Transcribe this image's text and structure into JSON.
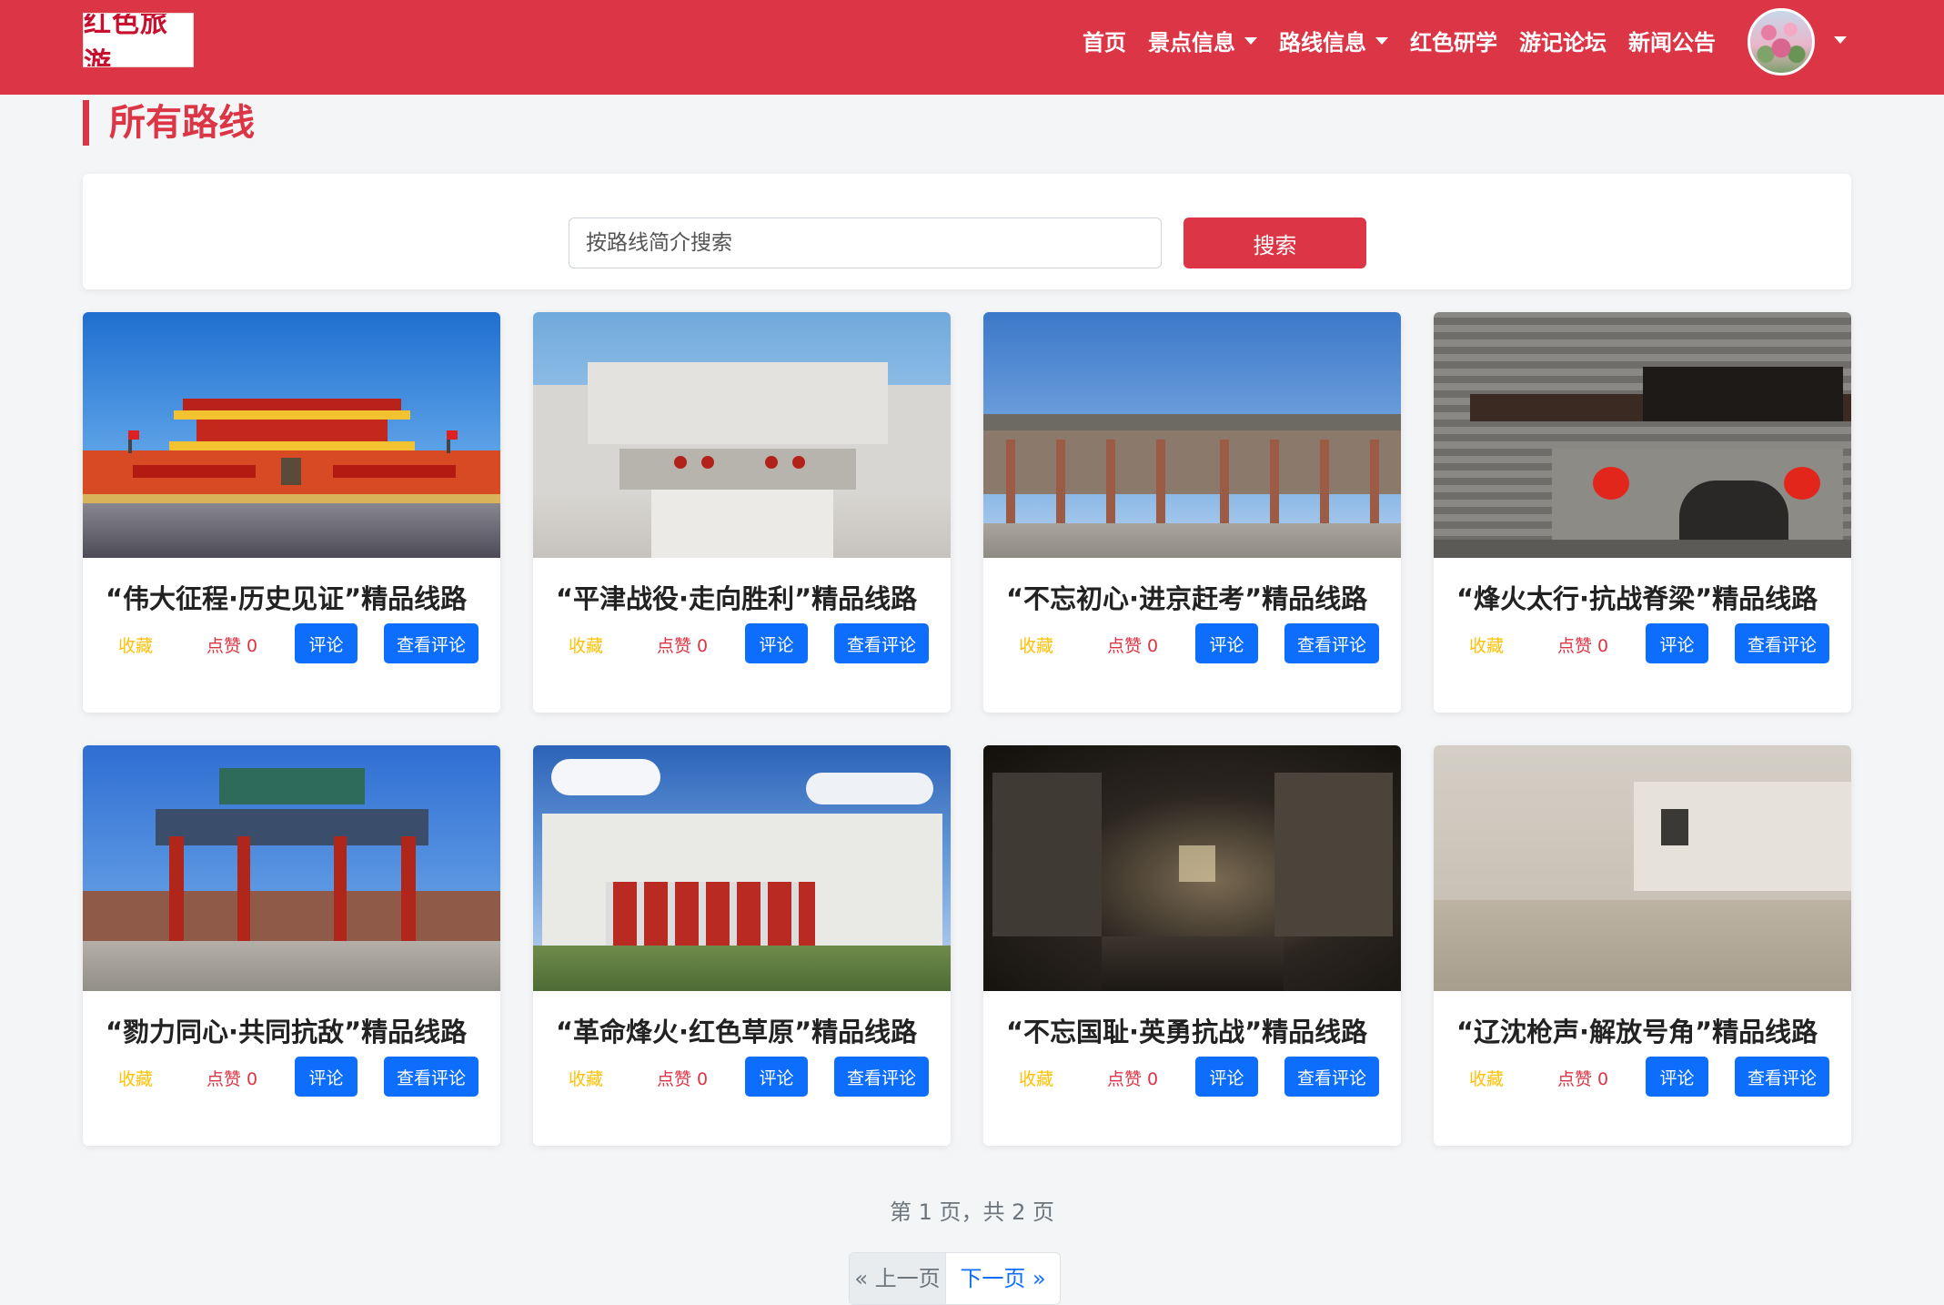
{
  "brand": {
    "logo_text": "红色旅游"
  },
  "nav": {
    "items": [
      {
        "label": "首页",
        "dropdown": false
      },
      {
        "label": "景点信息",
        "dropdown": true
      },
      {
        "label": "路线信息",
        "dropdown": true
      },
      {
        "label": "红色研学",
        "dropdown": false
      },
      {
        "label": "游记论坛",
        "dropdown": false
      },
      {
        "label": "新闻公告",
        "dropdown": false
      }
    ]
  },
  "page": {
    "title": "所有路线"
  },
  "search": {
    "placeholder": "按路线简介搜索",
    "value": "",
    "button_label": "搜索"
  },
  "cards": [
    {
      "title": "“伟大征程·历史见证”精品线路",
      "fav_label": "收藏",
      "like_label": "点赞 0",
      "comment_label": "评论",
      "view_label": "查看评论",
      "image": "tiananmen"
    },
    {
      "title": "“平津战役·走向胜利”精品线路",
      "fav_label": "收藏",
      "like_label": "点赞 0",
      "comment_label": "评论",
      "view_label": "查看评论",
      "image": "pingjin-memorial"
    },
    {
      "title": "“不忘初心·进京赶考”精品线路",
      "fav_label": "收藏",
      "like_label": "点赞 0",
      "comment_label": "评论",
      "view_label": "查看评论",
      "image": "xibaipo-memorial"
    },
    {
      "title": "“烽火太行·抗战脊梁”精品线路",
      "fav_label": "收藏",
      "like_label": "点赞 0",
      "comment_label": "评论",
      "view_label": "查看评论",
      "image": "liping-memorial"
    },
    {
      "title": "“勠力同心·共同抗敌”精品线路",
      "fav_label": "收藏",
      "like_label": "点赞 0",
      "comment_label": "评论",
      "view_label": "查看评论",
      "image": "paifang-gate"
    },
    {
      "title": "“革命烽火·红色草原”精品线路",
      "fav_label": "收藏",
      "like_label": "点赞 0",
      "comment_label": "评论",
      "view_label": "查看评论",
      "image": "inner-mongolia-memorial"
    },
    {
      "title": "“不忘国耻·英勇抗战”精品线路",
      "fav_label": "收藏",
      "like_label": "点赞 0",
      "comment_label": "评论",
      "view_label": "查看评论",
      "image": "exhibition-hall"
    },
    {
      "title": "“辽沈枪声·解放号角”精品线路",
      "fav_label": "收藏",
      "like_label": "点赞 0",
      "comment_label": "评论",
      "view_label": "查看评论",
      "image": "liaoshen-memorial"
    }
  ],
  "pagination": {
    "info": "第 1 页，共 2 页",
    "prev_label": "« 上一页",
    "next_label": "下一页 »"
  },
  "colors": {
    "brand_red": "#dc3545",
    "button_blue": "#0d6efd",
    "fav_yellow": "#ffc107"
  }
}
